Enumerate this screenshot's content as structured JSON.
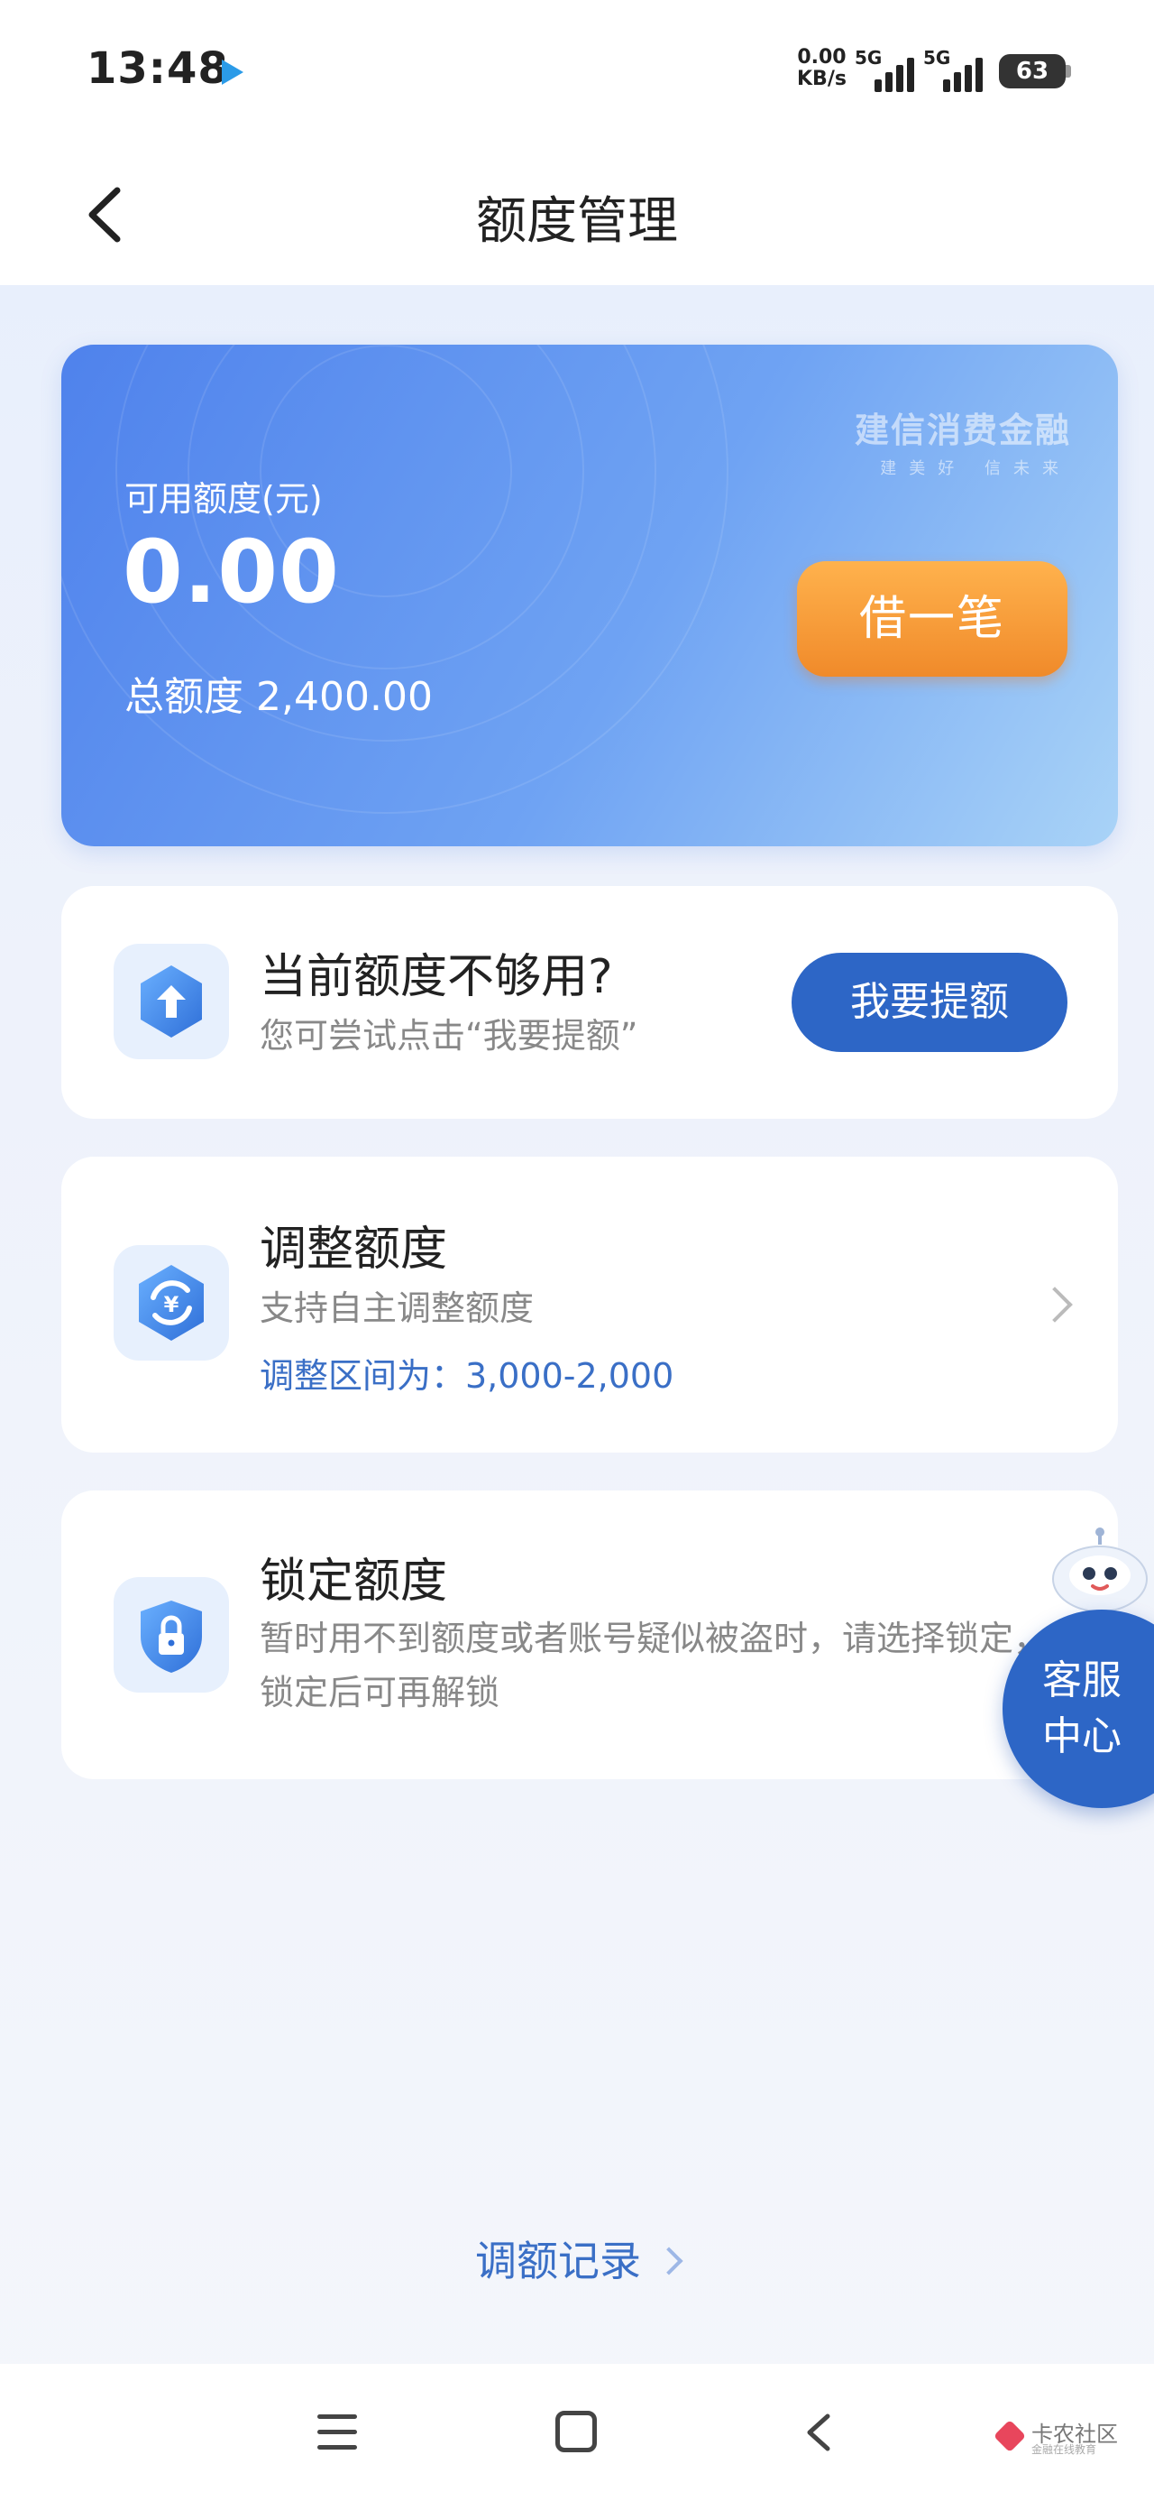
{
  "status_bar": {
    "time": "13:48",
    "net_speed_value": "0.00",
    "net_speed_unit": "KB/s",
    "signal1_label": "5G",
    "signal2_label": "5G",
    "battery": "63"
  },
  "nav": {
    "title": "额度管理"
  },
  "credit_card": {
    "brand_name": "建信消费金融",
    "brand_slogan": "建美好  信未来",
    "available_label": "可用额度(元)",
    "available_amount": "0.00",
    "total_label": "总额度",
    "total_amount": "2,400.00",
    "borrow_button": "借一笔"
  },
  "raise_panel": {
    "title": "当前额度不够用?",
    "subtitle": "您可尝试点击“我要提额”",
    "button": "我要提额",
    "icon": "arrow-up-hexagon-icon"
  },
  "adjust_panel": {
    "title": "调整额度",
    "subtitle": "支持自主调整额度",
    "range_text": "调整区间为：3,000-2,000",
    "icon": "yuan-refresh-icon"
  },
  "lock_panel": {
    "title": "锁定额度",
    "description": "暂时用不到额度或者账号疑似被盗时，请选择锁定，锁定后可再解锁",
    "icon": "lock-shield-icon"
  },
  "service": {
    "label": "客服中心",
    "icon": "robot-mascot-icon"
  },
  "history": {
    "label": "调额记录"
  },
  "watermark": {
    "text": "卡农社区",
    "sub": "金融在线教育"
  },
  "colors": {
    "primary": "#2d66c6",
    "accent_orange": "#f08a2a",
    "card_gradient_start": "#4f82ec",
    "card_gradient_end": "#a9d3f7"
  }
}
